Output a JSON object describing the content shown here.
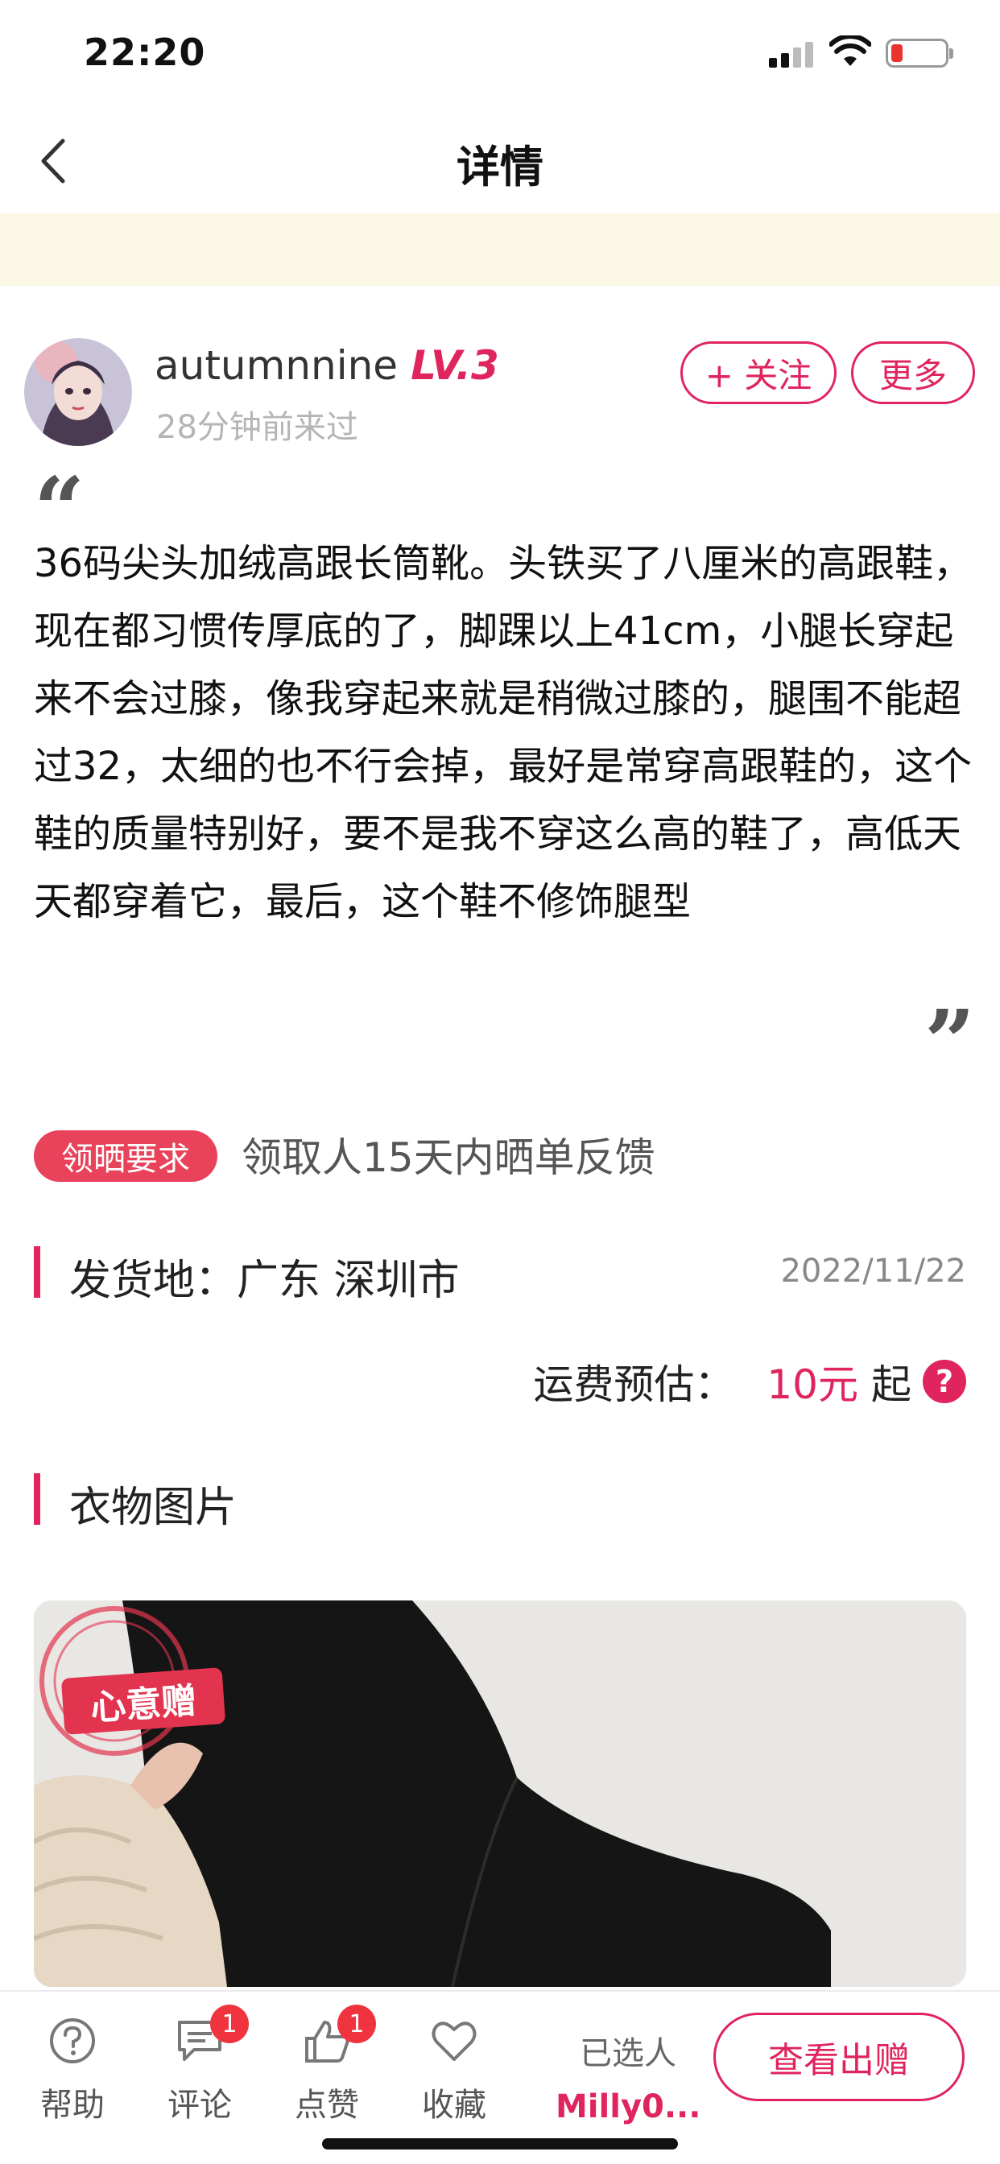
{
  "status_bar": {
    "time": "22:20"
  },
  "nav": {
    "title": "详情"
  },
  "user": {
    "name": "autumnnine",
    "level": "LV.3",
    "last_seen": "28分钟前来过",
    "follow_label": "+ 关注",
    "more_label": "更多"
  },
  "post": {
    "text": "36码尖头加绒高跟长筒靴。头铁买了八厘米的高跟鞋，现在都习惯传厚底的了，脚踝以上41cm，小腿长穿起来不会过膝，像我穿起来就是稍微过膝的，腿围不能超过32，太细的也不行会掉，最好是常穿高跟鞋的，这个鞋的质量特别好，要不是我不穿这么高的鞋了，高低天天都穿着它，最后，这个鞋不修饰腿型"
  },
  "requirement": {
    "badge": "领晒要求",
    "text": "领取人15天内晒单反馈"
  },
  "origin": {
    "label": "发货地：广东 深圳市",
    "date": "2022/11/22"
  },
  "shipping": {
    "label": "运费预估：",
    "price": "10元",
    "suffix": "起",
    "help": "?"
  },
  "photos": {
    "title": "衣物图片",
    "stamp_text": "心意赠"
  },
  "bottom_bar": {
    "help_label": "帮助",
    "comment_label": "评论",
    "comment_count": "1",
    "like_label": "点赞",
    "like_count": "1",
    "favorite_label": "收藏",
    "selected_label": "已选人",
    "selected_name": "Milly0...",
    "view_button": "查看出赠"
  },
  "colors": {
    "accent": "#e0245e",
    "notice_bg": "#fbf7e6"
  }
}
